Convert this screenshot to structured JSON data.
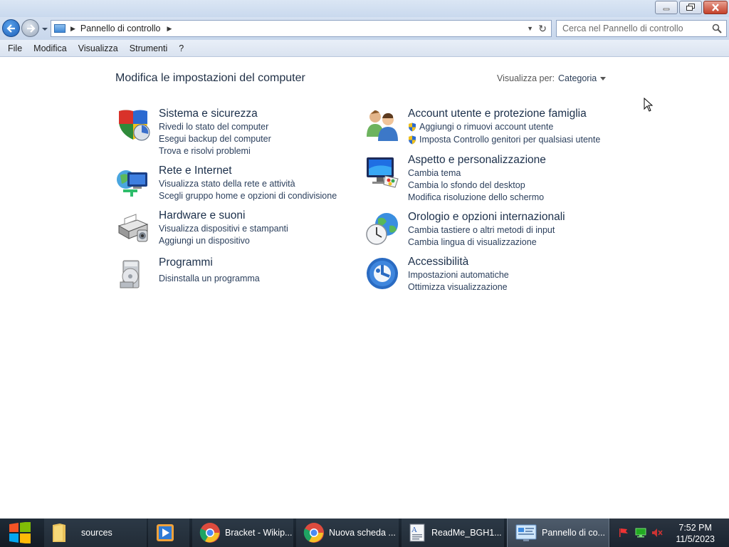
{
  "window": {
    "minimize": "minimize",
    "maximize": "restore",
    "close": "close"
  },
  "address": {
    "crumb": "Pannello di controllo",
    "search_placeholder": "Cerca nel Pannello di controllo"
  },
  "menu": [
    "File",
    "Modifica",
    "Visualizza",
    "Strumenti",
    "?"
  ],
  "page": {
    "title": "Modifica le impostazioni del computer",
    "view_by_label": "Visualizza per:",
    "view_by_value": "Categoria"
  },
  "categories": [
    {
      "title": "Sistema e sicurezza",
      "icon": "shield-icon",
      "links": [
        "Rivedi lo stato del computer",
        "Esegui backup del computer",
        "Trova e risolvi problemi"
      ]
    },
    {
      "title": "Rete e Internet",
      "icon": "network-icon",
      "links": [
        "Visualizza stato della rete e attività",
        "Scegli gruppo home e opzioni di condivisione"
      ]
    },
    {
      "title": "Hardware e suoni",
      "icon": "printer-icon",
      "links": [
        "Visualizza dispositivi e stampanti",
        "Aggiungi un dispositivo"
      ]
    },
    {
      "title": "Programmi",
      "icon": "programs-icon",
      "links": [
        "Disinstalla un programma"
      ]
    },
    {
      "title": "Account utente e protezione famiglia",
      "icon": "users-icon",
      "links": [
        "Aggiungi o rimuovi account utente",
        "Imposta Controllo genitori per qualsiasi utente"
      ]
    },
    {
      "title": "Aspetto e personalizzazione",
      "icon": "monitor-icon",
      "links": [
        "Cambia tema",
        "Cambia lo sfondo del desktop",
        "Modifica risoluzione dello schermo"
      ]
    },
    {
      "title": "Orologio e opzioni internazionali",
      "icon": "clock-globe-icon",
      "links": [
        "Cambia tastiere o altri metodi di input",
        "Cambia lingua di visualizzazione"
      ]
    },
    {
      "title": "Accessibilità",
      "icon": "accessibility-icon",
      "links": [
        "Impostazioni automatiche",
        "Ottimizza visualizzazione"
      ]
    }
  ],
  "taskbar": {
    "items": [
      {
        "label": "sources",
        "icon": "folder-icon"
      },
      {
        "label": "",
        "icon": "media-player-icon"
      },
      {
        "label": "Bracket - Wikip...",
        "icon": "chrome-icon"
      },
      {
        "label": "Nuova scheda ...",
        "icon": "chrome-icon"
      },
      {
        "label": "ReadMe_BGH1...",
        "icon": "wordpad-icon"
      },
      {
        "label": "Pannello di co...",
        "icon": "control-panel-icon"
      }
    ],
    "time": "7:52 PM",
    "date": "11/5/2023"
  }
}
